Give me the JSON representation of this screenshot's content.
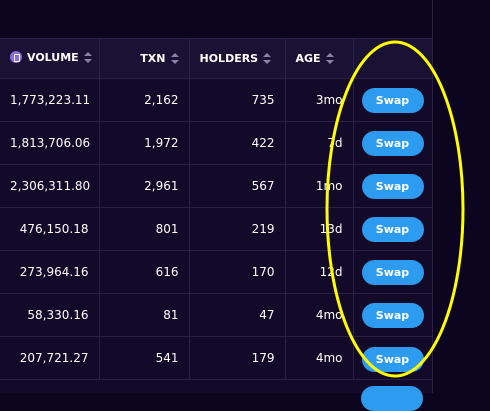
{
  "table": {
    "headers": {
      "volume": "VOLUME",
      "txn": "TXN",
      "holders": "HOLDERS",
      "age": "AGE"
    },
    "icons": {
      "volume_currency": "eth-coin-icon",
      "sort": "sort-arrows-icon"
    },
    "rows": [
      {
        "volume": "1,773,223.11",
        "txn": "2,162",
        "holders": "735",
        "age": "3mo",
        "action": "Swap"
      },
      {
        "volume": "1,813,706.06",
        "txn": "1,972",
        "holders": "422",
        "age": "7d",
        "action": "Swap"
      },
      {
        "volume": "2,306,311.80",
        "txn": "2,961",
        "holders": "567",
        "age": "1mo",
        "action": "Swap"
      },
      {
        "volume": "476,150.18",
        "txn": "801",
        "holders": "219",
        "age": "13d",
        "action": "Swap"
      },
      {
        "volume": "273,964.16",
        "txn": "616",
        "holders": "170",
        "age": "12d",
        "action": "Swap"
      },
      {
        "volume": "58,330.16",
        "txn": "81",
        "holders": "47",
        "age": "4mo",
        "action": "Swap"
      },
      {
        "volume": "207,721.27",
        "txn": "541",
        "holders": "179",
        "age": "4mo",
        "action": "Swap"
      }
    ]
  },
  "colors": {
    "background": "#0c0520",
    "panel": "#120a28",
    "header": "#1a1235",
    "swap_button": "#2d9cf0",
    "highlight_annotation": "#ffff00"
  }
}
